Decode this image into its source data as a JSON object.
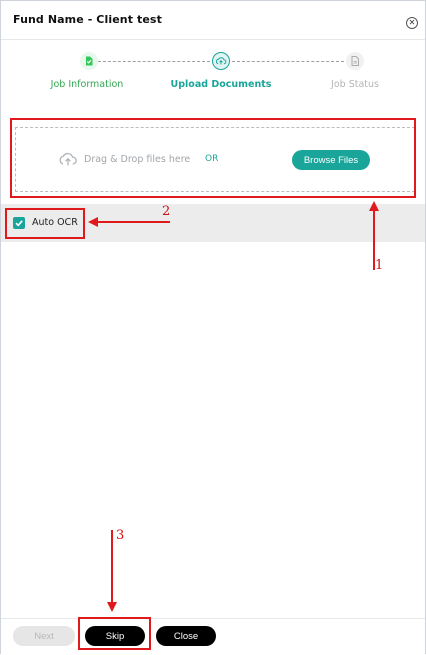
{
  "dialog": {
    "title": "Fund Name - Client test",
    "close_icon": "close-icon"
  },
  "stepper": {
    "steps": [
      {
        "label": "Job Information",
        "icon": "document-check-icon",
        "state": "completed",
        "color": "#34c759"
      },
      {
        "label": "Upload Documents",
        "icon": "cloud-upload-icon",
        "state": "active",
        "color": "#1aa59a"
      },
      {
        "label": "Job Status",
        "icon": "document-icon",
        "state": "pending",
        "color": "#b8b8b8"
      }
    ]
  },
  "upload": {
    "drag_text": "Drag & Drop files here",
    "or_text": "OR",
    "browse_label": "Browse Files",
    "icon": "cloud-upload-icon"
  },
  "options": {
    "auto_ocr_label": "Auto OCR",
    "auto_ocr_checked": true
  },
  "footer": {
    "next_label": "Next",
    "skip_label": "Skip",
    "close_label": "Close"
  },
  "annotations": {
    "n1": "1",
    "n2": "2",
    "n3": "3",
    "color": "#e0191d"
  },
  "colors": {
    "accent": "#1aa59a",
    "annotation": "#e0191d"
  }
}
